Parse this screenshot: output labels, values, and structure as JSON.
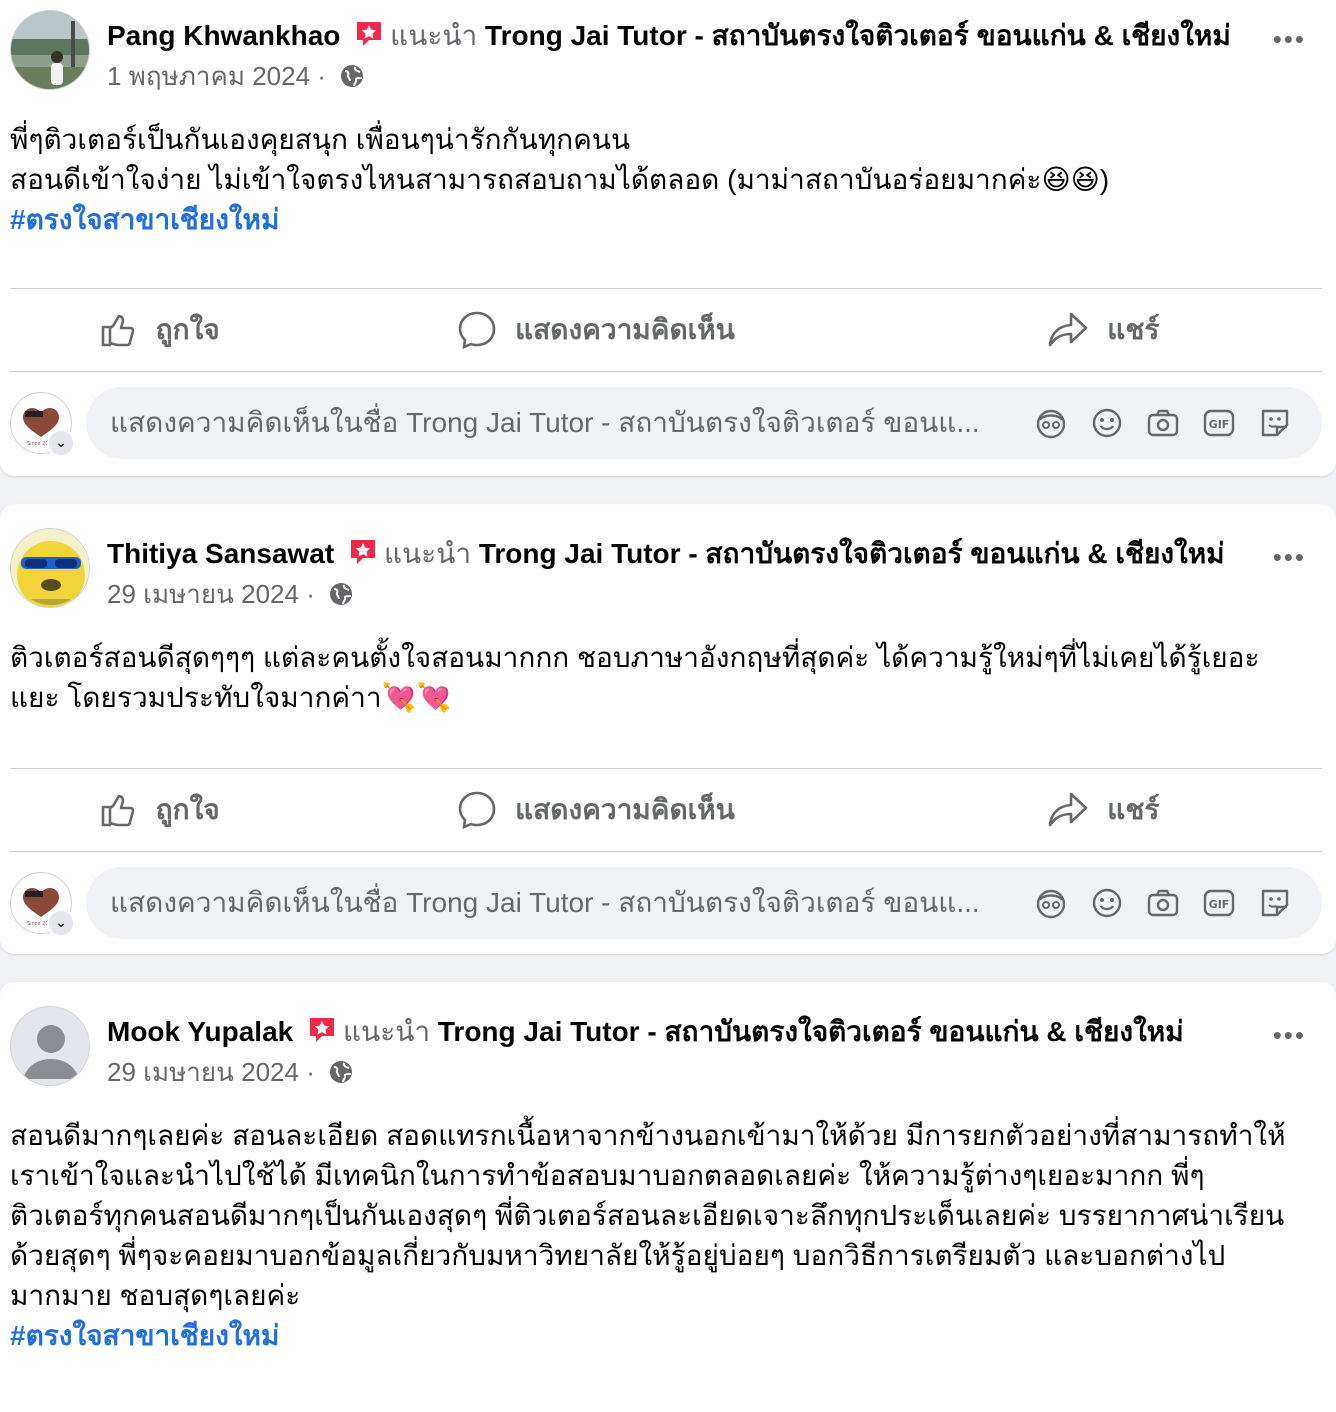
{
  "recommend_label": "แนะนำ",
  "page_name": "Trong Jai Tutor - สถาบันตรงใจติวเตอร์ ขอนแก่น & เชียงใหม่",
  "actions": {
    "like": "ถูกใจ",
    "comment": "แสดงความคิดเห็น",
    "share": "แชร์"
  },
  "comment_placeholder": "แสดงความคิดเห็นในชื่อ Trong Jai Tutor - สถาบันตรงใจติวเตอร์ ขอนแ...",
  "more_label": "•••",
  "badge_color": "#f02849",
  "hashtag_color": "#216fdb",
  "posts": [
    {
      "author": "Pang Khwankhao",
      "date": "1 พฤษภาคม 2024",
      "separator": "·",
      "text_lines": [
        "พี่ๆติวเตอร์เป็นกันเองคุยสนุก เพื่อนๆน่ารักกันทุกคนน",
        "สอนดีเข้าใจง่าย ไม่เข้าใจตรงไหนสามารถสอบถามได้ตลอด (มาม่าสถาบันอร่อยมากค่ะ😆😆)"
      ],
      "hashtag": "#ตรงใจสาขาเชียงใหม่"
    },
    {
      "author": "Thitiya Sansawat",
      "date": "29 เมษายน 2024",
      "separator": "·",
      "text_lines": [
        "ติวเตอร์สอนดีสุดๆๆๆ แต่ละคนตั้งใจสอนมากกก ชอบภาษาอังกฤษที่สุดค่ะ ได้ความรู้ใหม่ๆที่ไม่เคยได้รู้เยอะ",
        "แยะ โดยรวมประทับใจมากค่าา💘💘"
      ],
      "hashtag": ""
    },
    {
      "author": "Mook Yupalak",
      "date": "29 เมษายน 2024",
      "separator": "·",
      "text_lines": [
        "สอนดีมากๆเลยค่ะ สอนละเอียด สอดแทรกเนื้อหาจากข้างนอกเข้ามาให้ด้วย มีการยกตัวอย่างที่สามารถทำให้",
        "เราเข้าใจและนำไปใช้ได้ มีเทคนิกในการทำข้อสอบมาบอกตลอดเลยค่ะ ให้ความรู้ต่างๆเยอะมากก  พี่ๆ",
        "ติวเตอร์ทุกคนสอนดีมากๆเป็นกันเองสุดๆ พี่ติวเตอร์สอนละเอียดเจาะลึกทุกประเด็นเลยค่ะ บรรยากาศน่าเรียน",
        "ด้วยสุดๆ พี่ๆจะคอยมาบอกข้อมูลเกี่ยวกับมหาวิทยาลัยให้รู้อยู่บ่อยๆ บอกวิธีการเตรียมตัว และบอกต่างไป",
        "มากมาย ชอบสุดๆเลยค่ะ"
      ],
      "hashtag": "#ตรงใจสาขาเชียงใหม่"
    }
  ]
}
